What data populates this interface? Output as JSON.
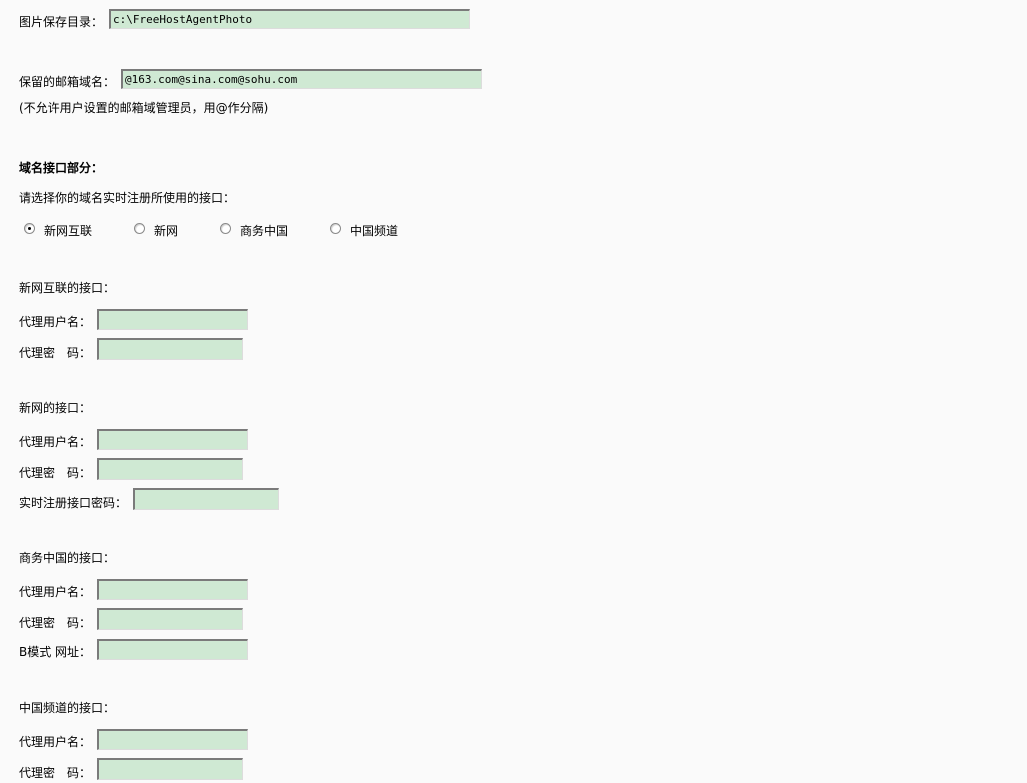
{
  "photo": {
    "label": "图片保存目录：",
    "value": "c:\\FreeHostAgentPhoto"
  },
  "reserved": {
    "label": "保留的邮箱域名：",
    "value": "@163.com@sina.com@sohu.com",
    "note": "(不允许用户设置的邮箱域管理员，用@作分隔)"
  },
  "interface": {
    "section_title": "域名接口部分：",
    "prompt": "请选择你的域名实时注册所使用的接口：",
    "options": [
      "新网互联",
      "新网",
      "商务中国",
      "中国频道"
    ],
    "selected": "新网互联"
  },
  "xinnet_hl": {
    "title": "新网互联的接口：",
    "user_label": "代理用户名：",
    "pass_label": "代理密　码："
  },
  "xinnet": {
    "title": "新网的接口：",
    "user_label": "代理用户名：",
    "pass_label": "代理密　码：",
    "rt_label": "实时注册接口密码："
  },
  "bizcn": {
    "title": "商务中国的接口：",
    "user_label": "代理用户名：",
    "pass_label": "代理密　码：",
    "url_label": "B模式 网址："
  },
  "chinach": {
    "title": "中国频道的接口：",
    "user_label": "代理用户名：",
    "pass_label": "代理密　码："
  }
}
